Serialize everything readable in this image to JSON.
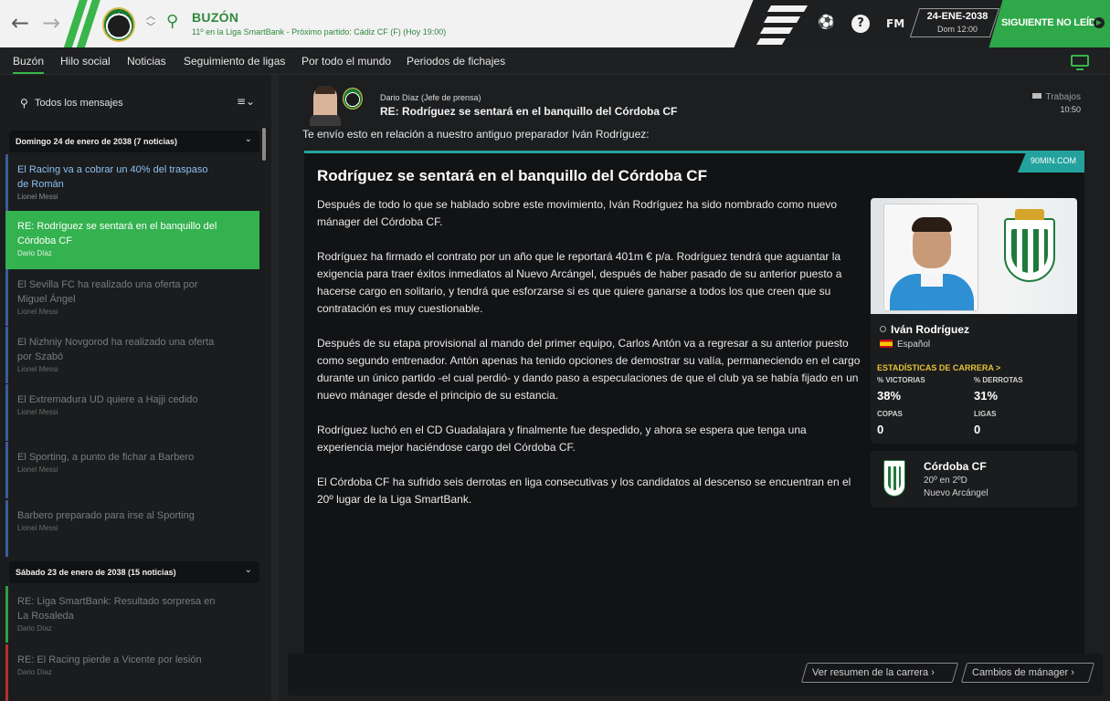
{
  "header": {
    "title": "BUZÓN",
    "subtitle": "11º en la Liga SmartBank - Próximo partido: Cádiz CF (F) (Hoy 19:00)",
    "fm_label": "FM",
    "help_label": "?",
    "date": "24-ENE-2038",
    "day_time": "Dom 12:00",
    "next_button": "SIGUIENTE NO LEÍDO",
    "colors": {
      "accent": "#39b54a",
      "title": "#2d8a3b"
    }
  },
  "nav": {
    "tabs": [
      "Buzón",
      "Hilo social",
      "Noticias",
      "Seguimiento de ligas",
      "Por todo el mundo",
      "Periodos de fichajes"
    ]
  },
  "sidebar": {
    "search_label": "Todos los mensajes",
    "menu_icon": "≡⌄",
    "groups": [
      {
        "label": "Domingo 24 de enero de 2038 (7 noticias)"
      },
      {
        "label": "Sábado 23 de enero de 2038 (15 noticias)"
      }
    ],
    "messages": [
      {
        "title": "El Racing va a cobrar un 40% del traspaso de Román",
        "author": "Lionel Messi"
      },
      {
        "title": "RE: Rodríguez se sentará en el banquillo del Córdoba CF",
        "author": "Dario Díaz"
      },
      {
        "title": "El Sevilla FC ha realizado una oferta por Miguel Ángel",
        "author": "Lionel Messi"
      },
      {
        "title": "El Nizhniy Novgorod ha realizado una oferta por Szabó",
        "author": "Lionel Messi"
      },
      {
        "title": "El Extremadura UD quiere a Hajji cedido",
        "author": "Lionel Messi"
      },
      {
        "title": "El Sporting, a punto de fichar a Barbero",
        "author": "Lionel Messi"
      },
      {
        "title": "Barbero preparado para irse al Sporting",
        "author": "Lionel Messi"
      },
      {
        "title": "RE: Liga SmartBank: Resultado sorpresa en La Rosaleda",
        "author": "Dario Díaz"
      },
      {
        "title": "RE: El Racing pierde a Vicente por lesión",
        "author": "Dario Díaz"
      }
    ]
  },
  "message": {
    "from": "Dario Díaz  (Jefe de prensa)",
    "subject": "RE: Rodríguez se sentará en el banquillo del Córdoba CF",
    "tag": "Trabajos",
    "time": "10:50",
    "intro": "Te envío esto en relación a nuestro antiguo preparador Iván Rodríguez:"
  },
  "article": {
    "source": "90MIN.COM",
    "headline": "Rodríguez se sentará en el banquillo del Córdoba CF",
    "paragraphs": [
      "Después de todo lo que se hablado sobre este movimiento, Iván Rodríguez ha sido nombrado como nuevo mánager del Córdoba CF.",
      "Rodríguez ha firmado el contrato por un año que le reportará 401m € p/a. Rodríguez tendrá que aguantar la exigencia para traer éxitos inmediatos al Nuevo Arcángel, después de haber pasado de su anterior puesto a hacerse cargo en solitario, y tendrá que esforzarse si es que quiere ganarse a todos los que creen que su contratación es muy cuestionable.",
      "Después de su etapa provisional al mando del primer equipo, Carlos Antón va a regresar a su anterior puesto como segundo entrenador. Antón apenas ha tenido opciones de demostrar su valía, permaneciendo en el cargo durante un único partido -el cual perdió- y dando paso a especulaciones de que el club ya se había fijado en un nuevo mánager desde el principio de su estancia.",
      "Rodríguez luchó en el CD Guadalajara y finalmente fue despedido, y ahora se espera que tenga una experiencia mejor haciéndose cargo del Córdoba CF.",
      "El Córdoba CF ha sufrido seis derrotas en liga consecutivas y los candidatos al descenso se encuentran en el 20º lugar de la Liga SmartBank."
    ]
  },
  "person": {
    "name": "Iván Rodríguez",
    "nationality": "Español",
    "stats_title": "ESTADÍSTICAS DE CARRERA >",
    "stats": [
      {
        "label": "% VICTORIAS",
        "value": "38%"
      },
      {
        "label": "% DERROTAS",
        "value": "31%"
      },
      {
        "label": "COPAS",
        "value": "0"
      },
      {
        "label": "LIGAS",
        "value": "0"
      }
    ]
  },
  "club": {
    "name": "Córdoba CF",
    "position": "20º en 2ºD",
    "stadium": "Nuevo Arcángel"
  },
  "footer": {
    "career_button": "Ver resumen de la carrera  ›",
    "changes_button": "Cambios de mánager  ›"
  }
}
